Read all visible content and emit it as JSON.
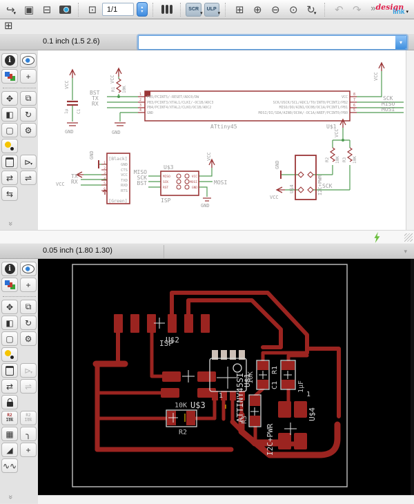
{
  "toolbar": {
    "sheet_selector": "1/1",
    "scr_label": "SCR",
    "ulp_label": "ULP",
    "more_label": "»",
    "brand": {
      "part1": "design",
      "part2": "link"
    }
  },
  "icons": {
    "open": "↪",
    "save": "▣",
    "print": "⊟",
    "sheet": "⊡",
    "zoom_fit": "⊞",
    "zoom_in": "⊕",
    "zoom_out": "⊖",
    "zoom_select": "⊙",
    "zoom_redraw": "↻",
    "undo": "↶",
    "redo": "↷",
    "dropdown": "▾",
    "stepper_up": "▴",
    "stepper_down": "▾",
    "grid": "⊞",
    "info": "i",
    "mark": "+",
    "move": "✥",
    "copy": "⧉",
    "mirror": "◧",
    "rotate": "↻",
    "group": "▢",
    "change": "⚙",
    "add": "⊳",
    "pinswap": "⇄",
    "replace": "⇌",
    "gateswap": "⇆",
    "more_tools": "»",
    "ratsnest": "▦",
    "route": "╮",
    "corner": "◢",
    "via": "+",
    "meander": "∿∿",
    "name_tool": {
      "top": "R2",
      "bottom": "10k"
    }
  },
  "schematic": {
    "param_bar": {
      "grid_info": "0.1 inch (1.5 2.6)",
      "command_value": ""
    },
    "power": {
      "vcc": "VCC",
      "gnd": "GND"
    },
    "c1": {
      "name": "C1",
      "value": "1μ"
    },
    "r1": {
      "name": "R1",
      "value": "10K"
    },
    "ic": {
      "name": "ATtiny45",
      "refdes": "U$1",
      "pin_numbers_left": [
        "1",
        "2",
        "3",
        "4"
      ],
      "pin_numbers_right": [
        "8",
        "7",
        "6",
        "5"
      ],
      "pins_left": [
        "PB5/PCINT5/-RESET/ADC0/DW",
        "PB3/PCINT3/XTAL1/CLKI/-OC1B/ADC3",
        "PB4/PCINT4/XTAL2/CLKO/OC1B/ADC2",
        "GND"
      ],
      "pins_right": [
        "VCC",
        "SCK/USCK/SCL/ADC1/T0/INT0/PCINT2/PB2",
        "MISO/DO/AIN1/OC0B/OC1A/PCINT1/PB1",
        "MOSI/DI/SDA/AIN0/OC0A/-OC1A/AREF/PCINT0/PB0"
      ]
    },
    "nets": {
      "bst": "BST",
      "tx": "TX",
      "rx": "RX",
      "sck": "SCK",
      "miso": "MISO",
      "mosi": "MOSI"
    },
    "ftdi": {
      "top_label": "[Black]",
      "bottom_label": "[Green]",
      "pin_numbers": [
        "1",
        "2",
        "3",
        "4",
        "5",
        "6"
      ],
      "pins": [
        "GND",
        "CTS",
        "VCC",
        "TXD",
        "RXD",
        "RTS"
      ]
    },
    "isp": {
      "refdes": "U$3",
      "label": "ISP",
      "pins_left": [
        "MISO",
        "SCK",
        "RST"
      ],
      "pins_right": [
        "VCC",
        "MOSI",
        "GND"
      ],
      "nets_left": [
        "MISO",
        "SCK",
        "BST"
      ],
      "net_right": "MOSI"
    },
    "i2c": {
      "refdes": "U$4",
      "label": "I2C+PWR",
      "r2": {
        "name": "R2",
        "value": "10K"
      },
      "r3": {
        "name": "R3",
        "value": "10K"
      },
      "net_sck": "SCK"
    }
  },
  "board": {
    "param_bar": {
      "grid_info": "0.05 inch (1.80 1.30)"
    },
    "labels": {
      "u2": "U$2",
      "isp": "ISP",
      "chip": "ATTINY45SI",
      "u1": "U$1",
      "r1_value": "10K",
      "c1": "C1",
      "r1": "R1",
      "c1_value": "1μF",
      "r3": "R3",
      "u3": "U$3",
      "u3_value": "10K",
      "r2": "R2",
      "u4": "U$4",
      "i2c": "I2C+PWR",
      "pin1_left": "1",
      "pin1_right": "1"
    }
  }
}
